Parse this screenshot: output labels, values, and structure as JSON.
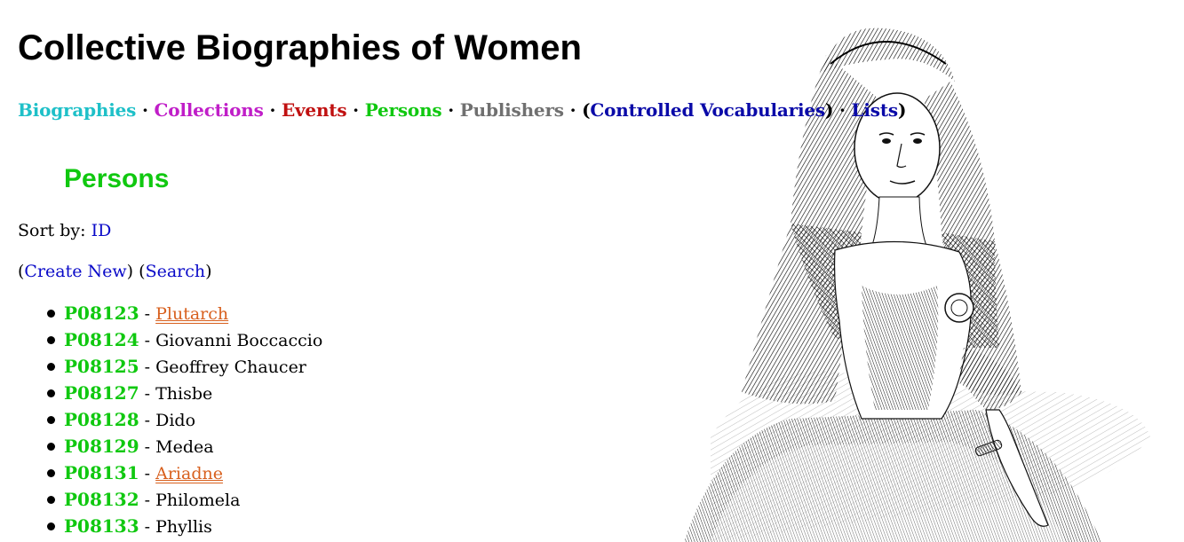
{
  "site": {
    "title": "Collective Biographies of Women"
  },
  "nav": {
    "items": [
      {
        "label": "Biographies",
        "color": "#1ec0c8"
      },
      {
        "label": "Collections",
        "color": "#c01ec8"
      },
      {
        "label": "Events",
        "color": "#c01010"
      },
      {
        "label": "Persons",
        "color": "#10c810"
      },
      {
        "label": "Publishers",
        "color": "#707070"
      }
    ],
    "separator": "·",
    "paren_open": "(",
    "paren_close": ")",
    "controlled_vocabularies": {
      "label": "Controlled Vocabularies",
      "color": "#0a0aa8"
    },
    "lists": {
      "label": "Lists",
      "color": "#0a0aa8"
    }
  },
  "page": {
    "heading": "Persons",
    "heading_color": "#10c810",
    "sort_label": "Sort by:",
    "sort_option": "ID",
    "create_new": "Create New",
    "search": "Search",
    "link_color": "#0a0ac8"
  },
  "persons": [
    {
      "id": "P08123",
      "name": "Plutarch",
      "linked": true
    },
    {
      "id": "P08124",
      "name": "Giovanni Boccaccio",
      "linked": false
    },
    {
      "id": "P08125",
      "name": "Geoffrey Chaucer",
      "linked": false
    },
    {
      "id": "P08127",
      "name": "Thisbe",
      "linked": false
    },
    {
      "id": "P08128",
      "name": "Dido",
      "linked": false
    },
    {
      "id": "P08129",
      "name": "Medea",
      "linked": false
    },
    {
      "id": "P08131",
      "name": "Ariadne",
      "linked": true
    },
    {
      "id": "P08132",
      "name": "Philomela",
      "linked": false
    },
    {
      "id": "P08133",
      "name": "Phyllis",
      "linked": false
    }
  ],
  "colors": {
    "person_id": "#10c810",
    "linked_name": "#d8601e"
  },
  "images": {
    "portrait": "engraved-portrait-woman-icon"
  }
}
